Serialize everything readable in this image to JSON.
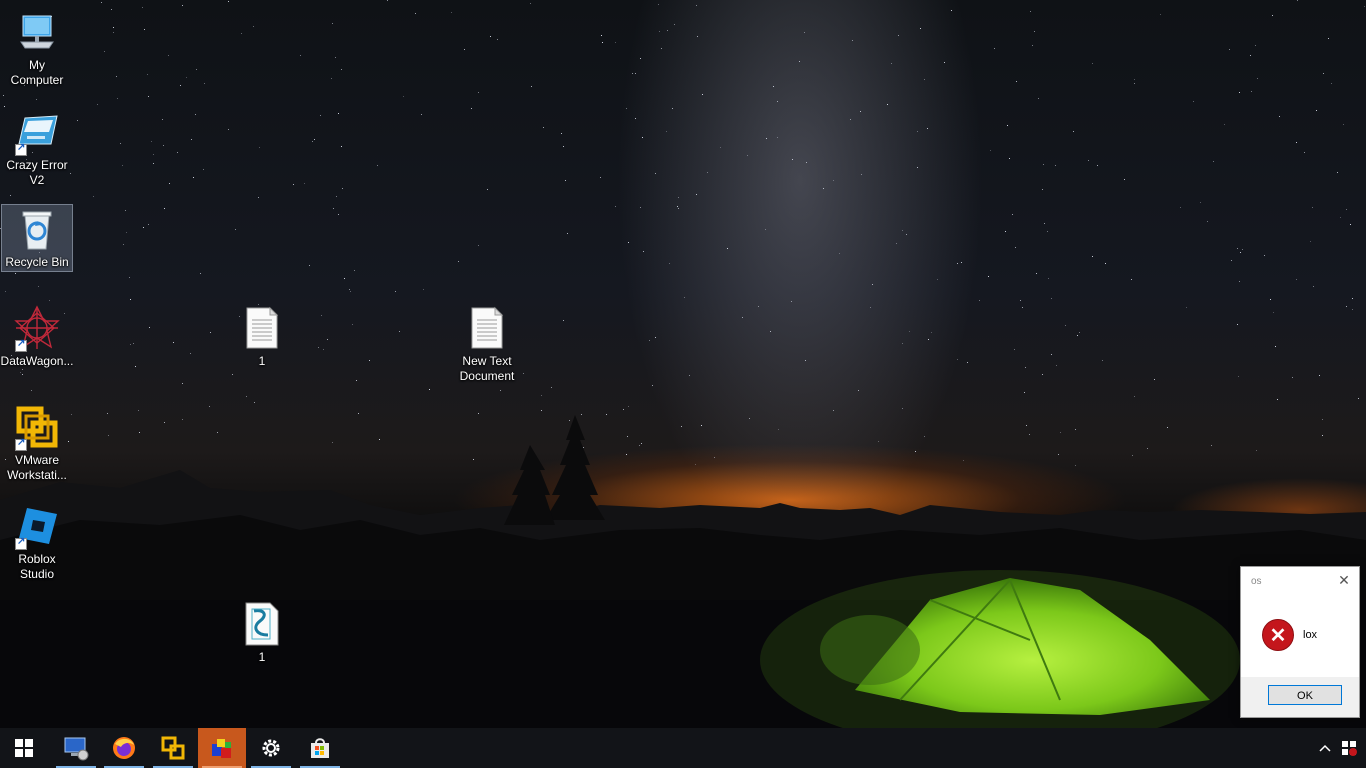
{
  "desktop": {
    "icons": [
      {
        "label": "My\nComputer",
        "name": "my-computer"
      },
      {
        "label": "Crazy Error\nV2",
        "name": "crazy-error-v2"
      },
      {
        "label": "Recycle Bin",
        "name": "recycle-bin"
      },
      {
        "label": "DataWagon...",
        "name": "datawagon"
      },
      {
        "label": "VMware\nWorkstati...",
        "name": "vmware-workstation"
      },
      {
        "label": "Roblox\nStudio",
        "name": "roblox-studio"
      },
      {
        "label": "1",
        "name": "text-file-1"
      },
      {
        "label": "New Text\nDocument",
        "name": "new-text-document"
      },
      {
        "label": "1",
        "name": "script-file-1"
      }
    ]
  },
  "dialog": {
    "title": "os",
    "message": "lox",
    "ok_label": "OK",
    "close_icon": "close-icon",
    "error_icon": "error-icon"
  },
  "taskbar": {
    "start_icon": "windows-start-icon",
    "apps": [
      {
        "name": "computer-app",
        "state": "running"
      },
      {
        "name": "firefox",
        "state": "running"
      },
      {
        "name": "vmware",
        "state": "running"
      },
      {
        "name": "paint-app",
        "state": "active"
      },
      {
        "name": "settings",
        "state": "running"
      },
      {
        "name": "microsoft-store",
        "state": "running"
      }
    ],
    "tray": {
      "chevron": "chevron-up-icon",
      "security": "security-icon"
    }
  },
  "colors": {
    "taskbar_bg": "#121418",
    "active_app": "#c8581d",
    "running_indicator": "#7fb4e6",
    "error_red": "#c4161c",
    "ok_border": "#0078d7"
  }
}
